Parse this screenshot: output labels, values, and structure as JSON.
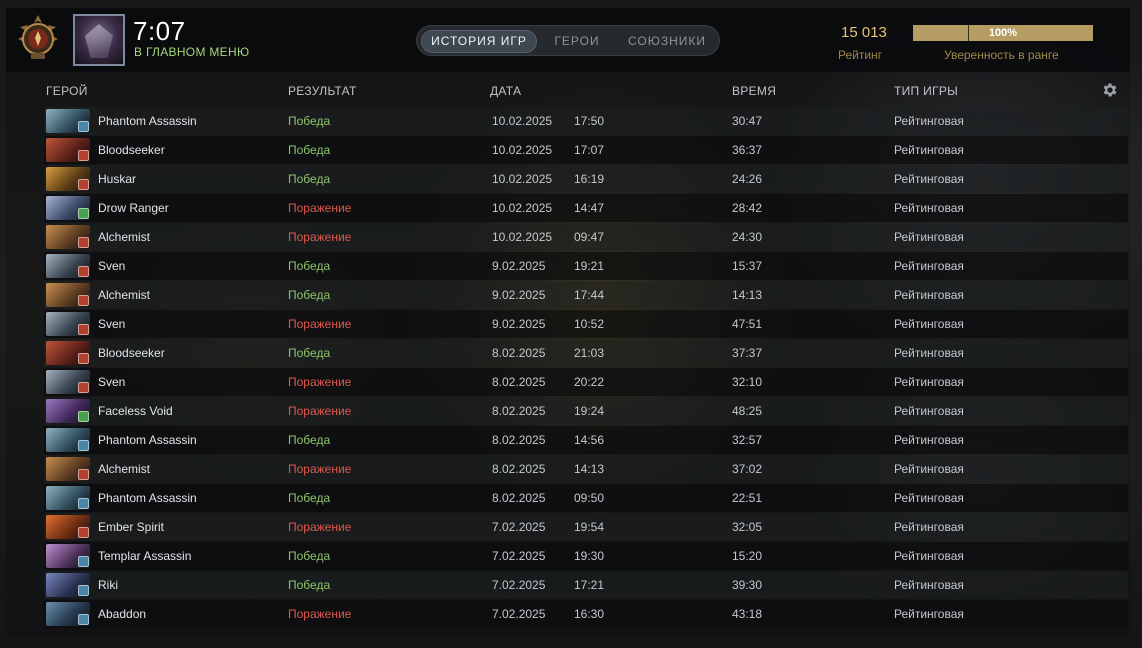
{
  "header": {
    "clock": "7:07",
    "status": "В ГЛАВНОМ МЕНЮ",
    "tabs": [
      {
        "label": "ИСТОРИЯ ИГР",
        "active": true
      },
      {
        "label": "ГЕРОИ",
        "active": false
      },
      {
        "label": "СОЮЗНИКИ",
        "active": false
      }
    ],
    "rating_value": "15 013",
    "rating_label": "Рейтинг",
    "confidence_value": "100%",
    "confidence_fraction": 1.0,
    "confidence_label": "Уверенность в ранге",
    "accent_color": "#e4c277"
  },
  "table": {
    "columns": {
      "hero": "ГЕРОЙ",
      "result": "РЕЗУЛЬТАТ",
      "date": "ДАТА",
      "duration": "ВРЕМЯ",
      "game_type": "ТИП ИГРЫ"
    },
    "settings_icon": "gear-icon",
    "rows": [
      {
        "hero": "Phantom Assassin",
        "result": "Победа",
        "win": true,
        "date": "10.02.2025",
        "time": "17:50",
        "duration": "30:47",
        "type": "Рейтинговая",
        "c1": "#2e4b5a",
        "c2": "#8fb3c2",
        "b": "#4a86a8"
      },
      {
        "hero": "Bloodseeker",
        "result": "Победа",
        "win": true,
        "date": "10.02.2025",
        "time": "17:07",
        "duration": "36:37",
        "type": "Рейтинговая",
        "c1": "#5a1e18",
        "c2": "#c0553a",
        "b": "#b04030"
      },
      {
        "hero": "Huskar",
        "result": "Победа",
        "win": true,
        "date": "10.02.2025",
        "time": "16:19",
        "duration": "24:26",
        "type": "Рейтинговая",
        "c1": "#5a3a14",
        "c2": "#d8a040",
        "b": "#b04030"
      },
      {
        "hero": "Drow Ranger",
        "result": "Поражение",
        "win": false,
        "date": "10.02.2025",
        "time": "14:47",
        "duration": "28:42",
        "type": "Рейтинговая",
        "c1": "#3a4868",
        "c2": "#a8b4d4",
        "b": "#4aa050"
      },
      {
        "hero": "Alchemist",
        "result": "Поражение",
        "win": false,
        "date": "10.02.2025",
        "time": "09:47",
        "duration": "24:30",
        "type": "Рейтинговая",
        "c1": "#5a3a20",
        "c2": "#c89050",
        "b": "#b04030"
      },
      {
        "hero": "Sven",
        "result": "Победа",
        "win": true,
        "date": "9.02.2025",
        "time": "19:21",
        "duration": "15:37",
        "type": "Рейтинговая",
        "c1": "#34404c",
        "c2": "#a4b4c0",
        "b": "#b04030"
      },
      {
        "hero": "Alchemist",
        "result": "Победа",
        "win": true,
        "date": "9.02.2025",
        "time": "17:44",
        "duration": "14:13",
        "type": "Рейтинговая",
        "c1": "#5a3a20",
        "c2": "#c89050",
        "b": "#b04030"
      },
      {
        "hero": "Sven",
        "result": "Поражение",
        "win": false,
        "date": "9.02.2025",
        "time": "10:52",
        "duration": "47:51",
        "type": "Рейтинговая",
        "c1": "#34404c",
        "c2": "#a4b4c0",
        "b": "#b04030"
      },
      {
        "hero": "Bloodseeker",
        "result": "Победа",
        "win": true,
        "date": "8.02.2025",
        "time": "21:03",
        "duration": "37:37",
        "type": "Рейтинговая",
        "c1": "#5a1e18",
        "c2": "#c0553a",
        "b": "#b04030"
      },
      {
        "hero": "Sven",
        "result": "Поражение",
        "win": false,
        "date": "8.02.2025",
        "time": "20:22",
        "duration": "32:10",
        "type": "Рейтинговая",
        "c1": "#34404c",
        "c2": "#a4b4c0",
        "b": "#b04030"
      },
      {
        "hero": "Faceless Void",
        "result": "Поражение",
        "win": false,
        "date": "8.02.2025",
        "time": "19:24",
        "duration": "48:25",
        "type": "Рейтинговая",
        "c1": "#40285a",
        "c2": "#9a78c0",
        "b": "#4aa050"
      },
      {
        "hero": "Phantom Assassin",
        "result": "Победа",
        "win": true,
        "date": "8.02.2025",
        "time": "14:56",
        "duration": "32:57",
        "type": "Рейтинговая",
        "c1": "#2e4b5a",
        "c2": "#8fb3c2",
        "b": "#4a86a8"
      },
      {
        "hero": "Alchemist",
        "result": "Поражение",
        "win": false,
        "date": "8.02.2025",
        "time": "14:13",
        "duration": "37:02",
        "type": "Рейтинговая",
        "c1": "#5a3a20",
        "c2": "#c89050",
        "b": "#b04030"
      },
      {
        "hero": "Phantom Assassin",
        "result": "Победа",
        "win": true,
        "date": "8.02.2025",
        "time": "09:50",
        "duration": "22:51",
        "type": "Рейтинговая",
        "c1": "#2e4b5a",
        "c2": "#8fb3c2",
        "b": "#4a86a8"
      },
      {
        "hero": "Ember Spirit",
        "result": "Поражение",
        "win": false,
        "date": "7.02.2025",
        "time": "19:54",
        "duration": "32:05",
        "type": "Рейтинговая",
        "c1": "#6a2a10",
        "c2": "#e07030",
        "b": "#b04030"
      },
      {
        "hero": "Templar Assassin",
        "result": "Победа",
        "win": true,
        "date": "7.02.2025",
        "time": "19:30",
        "duration": "15:20",
        "type": "Рейтинговая",
        "c1": "#4a3058",
        "c2": "#c090d0",
        "b": "#4a86a8"
      },
      {
        "hero": "Riki",
        "result": "Победа",
        "win": true,
        "date": "7.02.2025",
        "time": "17:21",
        "duration": "39:30",
        "type": "Рейтинговая",
        "c1": "#2a3050",
        "c2": "#7a88c0",
        "b": "#4a86a8"
      },
      {
        "hero": "Abaddon",
        "result": "Поражение",
        "win": false,
        "date": "7.02.2025",
        "time": "16:30",
        "duration": "43:18",
        "type": "Рейтинговая",
        "c1": "#24364a",
        "c2": "#6a90b0",
        "b": "#4a86a8"
      }
    ]
  }
}
